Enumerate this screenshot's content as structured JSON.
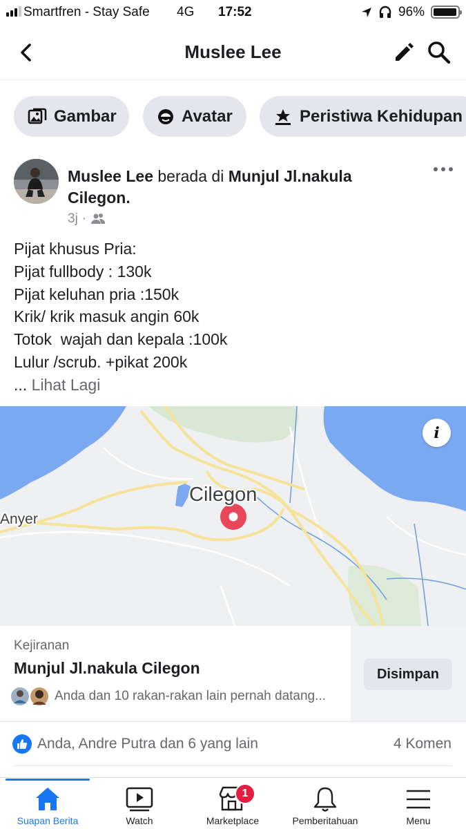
{
  "status_bar": {
    "carrier": "Smartfren - Stay Safe",
    "network": "4G",
    "time": "17:52",
    "battery": "96%",
    "icons": [
      "signal-icon",
      "location-arrow-icon",
      "headphones-icon",
      "battery-icon"
    ]
  },
  "header": {
    "title": "Muslee Lee",
    "back_icon": "back-chevron-icon",
    "edit_icon": "pencil-icon",
    "search_icon": "search-icon"
  },
  "actions": [
    {
      "label": "Gambar",
      "icon": "photo-icon"
    },
    {
      "label": "Avatar",
      "icon": "avatar-icon"
    },
    {
      "label": "Peristiwa Kehidupan",
      "icon": "life-event-icon"
    }
  ],
  "post": {
    "author": "Muslee Lee",
    "at_text": " berada di ",
    "place": "Munjul Jl.nakula Cilegon",
    "place_end": ".",
    "time": "3j",
    "audience_icon": "friends-icon",
    "body_lines": [
      "Pijat khusus Pria:",
      "Pijat fullbody : 130k",
      "Pijat keluhan pria :150k",
      "Krik/ krik masuk angin 60k",
      "Totok  wajah dan kepala :100k",
      "Lulur /scrub. +pikat 200k"
    ],
    "ellipsis": "... ",
    "see_more": "Lihat Lagi"
  },
  "map": {
    "city_label": "Cilegon",
    "town_label": "Anyer",
    "info_label": "i"
  },
  "place_card": {
    "category": "Kejiranan",
    "name": "Munjul Jl.nakula Cilegon",
    "visited_text": "Anda dan 10 rakan-rakan lain pernah datang...",
    "save_button": "Disimpan"
  },
  "reactions": {
    "likes_text": "Anda, Andre Putra dan 6 yang lain",
    "comments_text": "4 Komen"
  },
  "tabs": [
    {
      "label": "Suapan Berita",
      "icon": "home-icon",
      "active": true
    },
    {
      "label": "Watch",
      "icon": "watch-icon"
    },
    {
      "label": "Marketplace",
      "icon": "marketplace-icon",
      "badge": "1"
    },
    {
      "label": "Pemberitahuan",
      "icon": "bell-icon"
    },
    {
      "label": "Menu",
      "icon": "menu-icon"
    }
  ],
  "colors": {
    "accent": "#1877f2",
    "badge": "#e41e3f",
    "pin": "#e8475a",
    "water": "#7aa9f2"
  }
}
